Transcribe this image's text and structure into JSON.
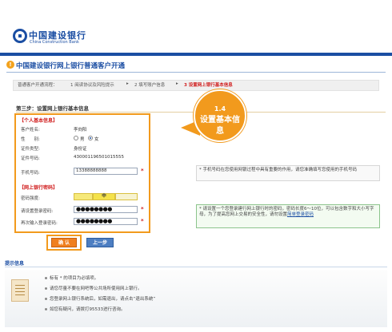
{
  "header": {
    "logo_cn": "中国建设银行",
    "logo_en": "China Construction Bank",
    "page_title": "中国建设银行网上银行普通客户开通"
  },
  "steps": {
    "prefix": "普通客户开通流程：",
    "items": [
      "1 阅读协议及风险提示",
      "2 填写账户信息",
      "3 设置网上银行基本信息"
    ],
    "arrow": "▸"
  },
  "section": {
    "title": "第三步：设置网上银行基本信息",
    "personal_head": "【个人基本信息】",
    "name_label": "客户姓名:",
    "name_value": "李向阳",
    "gender_label": "性　　别:",
    "gender_male": "男",
    "gender_female": "女",
    "gender_selected": "女",
    "id_type_label": "证件类型:",
    "id_type_value": "身份证",
    "id_no_label": "证件号码:",
    "id_no_value": "430001196501015555",
    "phone_label": "手机号码:",
    "phone_value": "13388888888",
    "pwd_head": "【网上银行密码】",
    "strength_label": "密码强度:",
    "strength_value": "中",
    "pwd_label": "请设置登录密码:",
    "pwd_value": "●●●●●●●●",
    "pwd2_label": "再次输入登录密码:",
    "pwd2_value": "●●●●●●●●",
    "required_mark": "*"
  },
  "callout": {
    "number": "1.4",
    "text": "设置基本信息"
  },
  "hints": {
    "phone_hint": "* 手机号码在您使用网银过程中具有重要的作用，请您准确填写您使用的手机号码",
    "pwd_hint_main": "* 请设置一个您登录建行网上银行时的密码，密码长度6～10位，可以包含数字和大小写字母，为了提高您网上交易的安全性，请勿设置",
    "pwd_hint_link": "简单登录密码"
  },
  "buttons": {
    "confirm": "确 认",
    "prev": "上一步"
  },
  "tips": {
    "title": "提示信息",
    "items": [
      "标有 * 的项目为必填项。",
      "请您尽量不要在网吧等公共场所使用网上银行。",
      "您登录网上银行系统后，如需退出，请点击“退出系统”",
      "如您有疑问，请拨打95533进行咨询。"
    ]
  }
}
